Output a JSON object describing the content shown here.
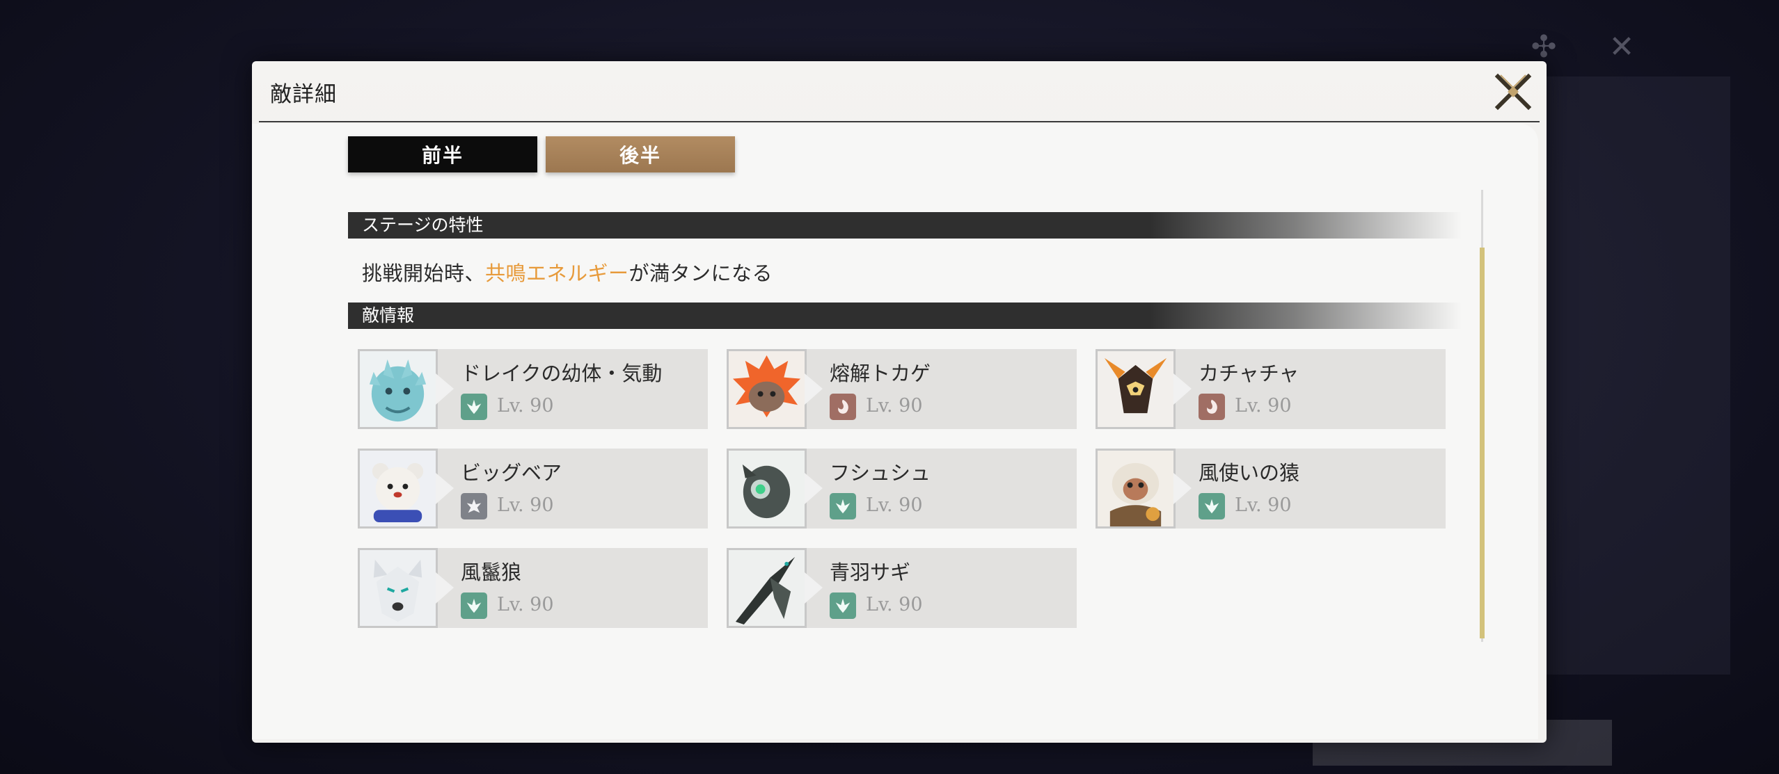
{
  "modal": {
    "title": "敵詳細",
    "close_icon": "close-icon"
  },
  "tabs": [
    {
      "label": "前半",
      "active": true
    },
    {
      "label": "後半",
      "active": false
    }
  ],
  "stage": {
    "header": "ステージの特性",
    "text_before": "挑戦開始時、",
    "text_highlight": "共鳴エネルギー",
    "text_after": "が満タンになる",
    "highlight_color": "#e79a3a"
  },
  "enemies_section": {
    "header": "敵情報",
    "enemies": [
      {
        "name": "ドレイクの幼体・気動",
        "level": "Lv. 90",
        "attribute_icon": "aero-attribute-icon",
        "color": "#5fa08a"
      },
      {
        "name": "熔解トカゲ",
        "level": "Lv. 90",
        "attribute_icon": "fusion-attribute-icon",
        "color": "#a06e64"
      },
      {
        "name": "カチャチャ",
        "level": "Lv. 90",
        "attribute_icon": "fusion-attribute-icon",
        "color": "#a06e64"
      },
      {
        "name": "ビッグベア",
        "level": "Lv. 90",
        "attribute_icon": "spectro-attribute-icon",
        "color": "#7f8289"
      },
      {
        "name": "フシュシュ",
        "level": "Lv. 90",
        "attribute_icon": "aero-attribute-icon",
        "color": "#5fa08a"
      },
      {
        "name": "風使いの猿",
        "level": "Lv. 90",
        "attribute_icon": "aero-attribute-icon",
        "color": "#5fa08a"
      },
      {
        "name": "風鬣狼",
        "level": "Lv. 90",
        "attribute_icon": "aero-attribute-icon",
        "color": "#5fa08a"
      },
      {
        "name": "青羽サギ",
        "level": "Lv. 90",
        "attribute_icon": "aero-attribute-icon",
        "color": "#5fa08a"
      }
    ]
  }
}
